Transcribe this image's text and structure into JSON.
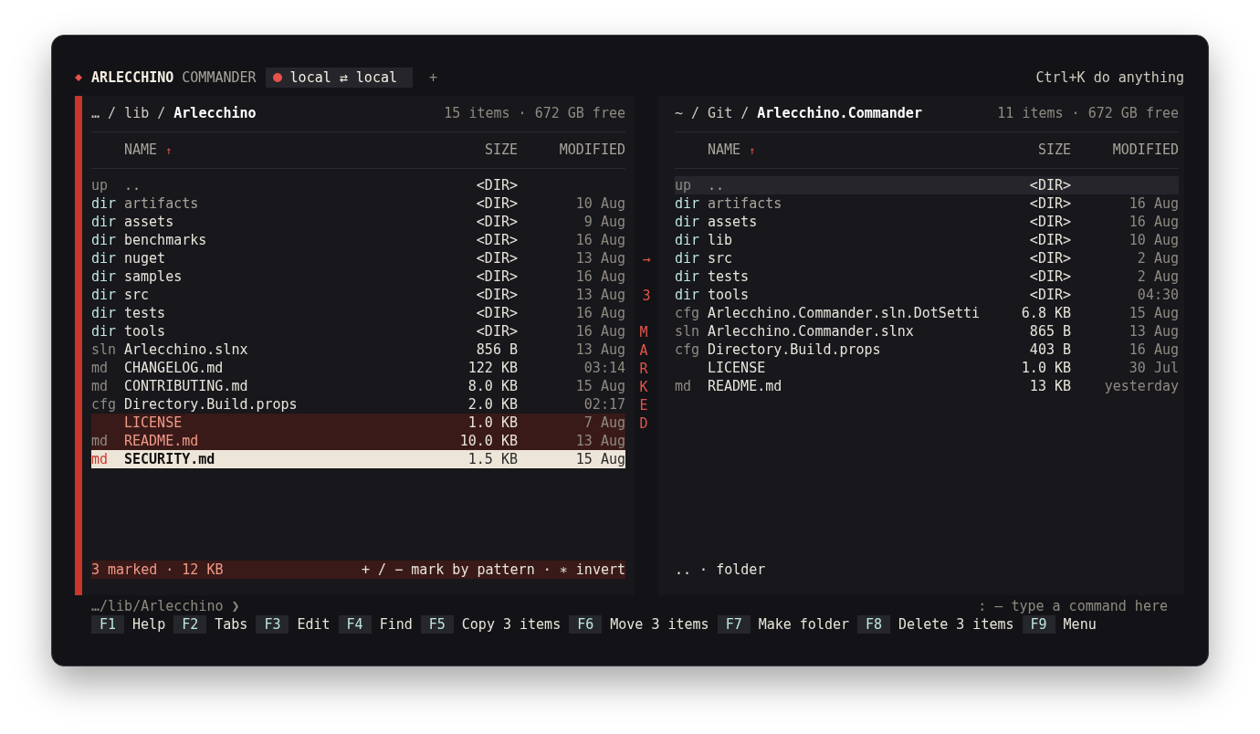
{
  "app": {
    "title": "ARLECCHINO",
    "subtitle": "COMMANDER",
    "tab": {
      "label": "local ⇄ local",
      "selected": true
    },
    "new_tab": "+",
    "hint": "Ctrl+K do anything"
  },
  "panels": [
    {
      "active": true,
      "path": "… / lib / **Arlecchino**",
      "meta": "15 items · 672 GB free",
      "columns": {
        "name": "NAME",
        "sort_arrow": "↑",
        "size": "SIZE",
        "modified": "MODIFIED"
      },
      "rows": [
        {
          "kind": "up",
          "type": "up",
          "name": "..",
          "size": "<DIR>",
          "hidden": true,
          "marked": false,
          "selected": false
        },
        {
          "kind": "dir",
          "type": "dir",
          "name": "artifacts",
          "size": "<DIR>",
          "modified": "10 Aug",
          "hidden": true,
          "marked": false,
          "selected": false
        },
        {
          "kind": "dir",
          "type": "dir",
          "name": "assets",
          "size": "<DIR>",
          "modified": "9 Aug",
          "hidden": false,
          "marked": false,
          "selected": false
        },
        {
          "kind": "dir",
          "type": "dir",
          "name": "benchmarks",
          "size": "<DIR>",
          "modified": "16 Aug",
          "hidden": false,
          "marked": false,
          "selected": false
        },
        {
          "kind": "dir",
          "type": "dir",
          "name": "nuget",
          "size": "<DIR>",
          "modified": "13 Aug",
          "hidden": false,
          "marked": false,
          "selected": false
        },
        {
          "kind": "dir",
          "type": "dir",
          "name": "samples",
          "size": "<DIR>",
          "modified": "16 Aug",
          "hidden": false,
          "marked": false,
          "selected": false
        },
        {
          "kind": "dir",
          "type": "dir",
          "name": "src",
          "size": "<DIR>",
          "modified": "13 Aug",
          "hidden": false,
          "marked": false,
          "selected": false
        },
        {
          "kind": "dir",
          "type": "dir",
          "name": "tests",
          "size": "<DIR>",
          "modified": "16 Aug",
          "hidden": false,
          "marked": false,
          "selected": false
        },
        {
          "kind": "dir",
          "type": "dir",
          "name": "tools",
          "size": "<DIR>",
          "modified": "16 Aug",
          "hidden": false,
          "marked": false,
          "selected": false
        },
        {
          "kind": "file",
          "type": "sln",
          "name": "Arlecchino.slnx",
          "size": "856 B",
          "modified": "13 Aug",
          "hidden": false,
          "marked": false,
          "selected": false
        },
        {
          "kind": "file",
          "type": "md",
          "name": "CHANGELOG.md",
          "size": "122 KB",
          "modified": "03:14",
          "hidden": false,
          "marked": false,
          "selected": false
        },
        {
          "kind": "file",
          "type": "md",
          "name": "CONTRIBUTING.md",
          "size": "8.0 KB",
          "modified": "15 Aug",
          "hidden": false,
          "marked": false,
          "selected": false
        },
        {
          "kind": "file",
          "type": "cfg",
          "name": "Directory.Build.props",
          "size": "2.0 KB",
          "modified": "02:17",
          "hidden": false,
          "marked": false,
          "selected": false
        },
        {
          "kind": "file",
          "name": "LICENSE",
          "size": "1.0 KB",
          "modified": "7 Aug",
          "hidden": false,
          "marked": true,
          "selected": false
        },
        {
          "kind": "file",
          "type": "md",
          "name": "README.md",
          "size": "10.0 KB",
          "modified": "13 Aug",
          "hidden": false,
          "marked": true,
          "selected": false
        },
        {
          "kind": "file",
          "type": "md",
          "name": "SECURITY.md",
          "size": "1.5 KB",
          "modified": "15 Aug",
          "hidden": false,
          "marked": true,
          "selected": true
        }
      ],
      "footer": {
        "kind": "marked",
        "summary": "3 marked · 12 KB",
        "hint": "+ / − mark by pattern · ∗ invert"
      }
    },
    {
      "active": false,
      "path": "~ / Git / **Arlecchino.Commander**",
      "meta": "11 items · 672 GB free",
      "columns": {
        "name": "NAME",
        "sort_arrow": "↑",
        "size": "SIZE",
        "modified": "MODIFIED"
      },
      "rows": [
        {
          "kind": "up",
          "type": "up",
          "name": "..",
          "size": "<DIR>",
          "hidden": true,
          "marked": false,
          "selected": true
        },
        {
          "kind": "dir",
          "type": "dir",
          "name": "artifacts",
          "size": "<DIR>",
          "modified": "16 Aug",
          "hidden": true,
          "marked": false,
          "selected": false
        },
        {
          "kind": "dir",
          "type": "dir",
          "name": "assets",
          "size": "<DIR>",
          "modified": "16 Aug",
          "hidden": false,
          "marked": false,
          "selected": false
        },
        {
          "kind": "dir",
          "type": "dir",
          "name": "lib",
          "size": "<DIR>",
          "modified": "10 Aug",
          "hidden": false,
          "marked": false,
          "selected": false
        },
        {
          "kind": "dir",
          "type": "dir",
          "name": "src",
          "size": "<DIR>",
          "modified": "2 Aug",
          "hidden": false,
          "marked": false,
          "selected": false
        },
        {
          "kind": "dir",
          "type": "dir",
          "name": "tests",
          "size": "<DIR>",
          "modified": "2 Aug",
          "hidden": false,
          "marked": false,
          "selected": false
        },
        {
          "kind": "dir",
          "type": "dir",
          "name": "tools",
          "size": "<DIR>",
          "modified": "04:30",
          "hidden": false,
          "marked": false,
          "selected": false
        },
        {
          "kind": "file",
          "type": "cfg",
          "name": "Arlecchino.Commander.sln.DotSetti",
          "size": "6.8 KB",
          "modified": "15 Aug",
          "hidden": false,
          "marked": false,
          "selected": false
        },
        {
          "kind": "file",
          "type": "sln",
          "name": "Arlecchino.Commander.slnx",
          "size": "865 B",
          "modified": "13 Aug",
          "hidden": false,
          "marked": false,
          "selected": false
        },
        {
          "kind": "file",
          "type": "cfg",
          "name": "Directory.Build.props",
          "size": "403 B",
          "modified": "16 Aug",
          "hidden": false,
          "marked": false,
          "selected": false
        },
        {
          "kind": "file",
          "name": "LICENSE",
          "size": "1.0 KB",
          "modified": "30 Jul",
          "hidden": false,
          "marked": false,
          "selected": false
        },
        {
          "kind": "file",
          "type": "md",
          "name": "README.md",
          "size": "13 KB",
          "modified": "yesterday",
          "hidden": false,
          "marked": false,
          "selected": false
        }
      ],
      "footer": {
        "kind": "info",
        "summary": ".. · folder"
      }
    }
  ],
  "gutter": {
    "arrow": "→",
    "count": "3",
    "label": "MARKED"
  },
  "prompt": {
    "path": "…/lib/Arlecchino ❯",
    "placeholder": ": — type a command here"
  },
  "function_keys": [
    {
      "key": "F1",
      "label": "Help"
    },
    {
      "key": "F2",
      "label": "Tabs"
    },
    {
      "key": "F3",
      "label": "Edit"
    },
    {
      "key": "F4",
      "label": "Find"
    },
    {
      "key": "F5",
      "label": "Copy 3 items"
    },
    {
      "key": "F6",
      "label": "Move 3 items"
    },
    {
      "key": "F7",
      "label": "Make folder"
    },
    {
      "key": "F8",
      "label": "Delete 3 items"
    },
    {
      "key": "F9",
      "label": "Menu"
    }
  ]
}
